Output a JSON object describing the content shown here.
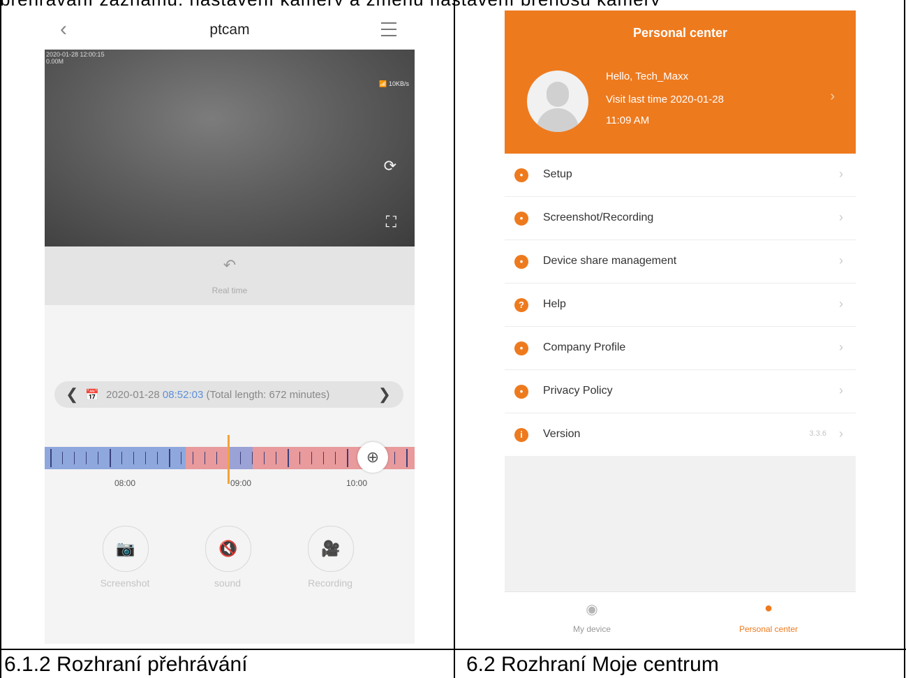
{
  "top_text": "přehrávání záznamu, nastavení kamery a změnu nastavení přenosu kamery",
  "captions": {
    "left": "6.1.2 Rozhraní přehrávání",
    "right": "6.2 Rozhraní Moje centrum"
  },
  "playback": {
    "title": "ptcam",
    "osd_line1": "2020-01-28 12:00:15",
    "osd_line2": "0.00M",
    "bitrate": "10KB/s",
    "real_time_label": "Real time",
    "date": "2020-01-28",
    "time": "08:52:03",
    "total_length": "(Total length: 672 minutes)",
    "timeline_labels": [
      "08:00",
      "09:00",
      "10:00"
    ],
    "actions": {
      "screenshot": "Screenshot",
      "sound": "sound",
      "recording": "Recording"
    }
  },
  "personal_center": {
    "title": "Personal center",
    "greeting": "Hello, Tech_Maxx",
    "visit_last": "Visit last time 2020-01-28",
    "visit_time": "11:09 AM",
    "menu": [
      {
        "label": "Setup",
        "icon": "gear-icon"
      },
      {
        "label": "Screenshot/Recording",
        "icon": "camera-icon"
      },
      {
        "label": "Device share management",
        "icon": "share-icon"
      },
      {
        "label": "Help",
        "icon": "help-icon"
      },
      {
        "label": "Company Profile",
        "icon": "company-icon"
      },
      {
        "label": "Privacy Policy",
        "icon": "privacy-icon"
      },
      {
        "label": "Version",
        "icon": "info-icon",
        "value": "3.3.6"
      }
    ],
    "tabs": {
      "my_device": "My device",
      "personal_center": "Personal center"
    }
  },
  "colors": {
    "accent_orange": "#ee7a1e",
    "timeline_red": "#e89a9c",
    "timeline_blue": "#8ea8dd",
    "time_blue": "#5b8fd9"
  }
}
